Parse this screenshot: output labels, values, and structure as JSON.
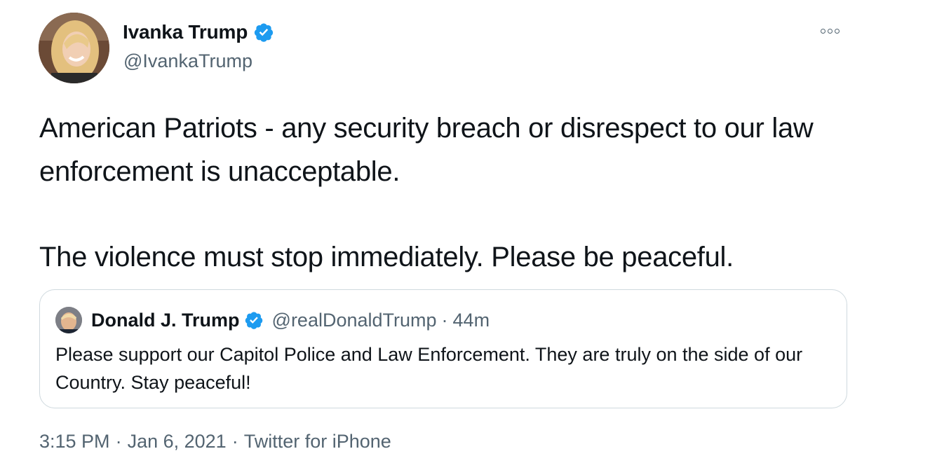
{
  "author": {
    "name": "Ivanka Trump",
    "handle": "@IvankaTrump",
    "verified": true,
    "verified_color": "#1d9bf0"
  },
  "tweet": {
    "paragraph_1": "American Patriots - any security breach or disrespect to our law enforcement is unacceptable.",
    "paragraph_2": "The violence must stop immediately. Please be peaceful."
  },
  "quoted_tweet": {
    "name": "Donald J. Trump",
    "handle": "@realDonaldTrump",
    "separator": "·",
    "time": "44m",
    "verified": true,
    "text": "Please support our Capitol Police and Law Enforcement. They are truly on the side of our Country. Stay peaceful!"
  },
  "meta": {
    "time": "3:15 PM",
    "separator": "·",
    "date": "Jan 6, 2021",
    "source": "Twitter for iPhone"
  },
  "icons": {
    "more": "more-options-icon",
    "verified": "verified-badge-icon"
  }
}
